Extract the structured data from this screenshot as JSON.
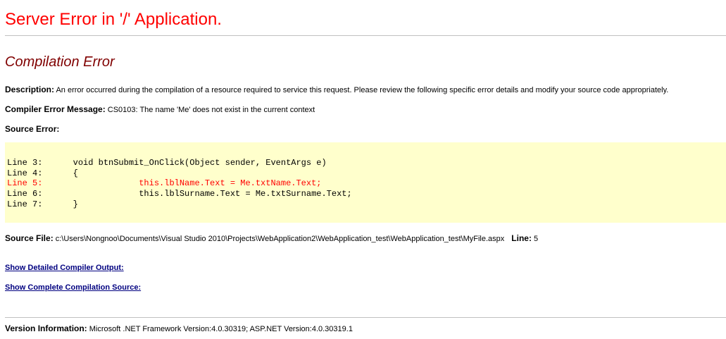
{
  "title": "Server Error in '/' Application.",
  "subtitle": "Compilation Error",
  "description": {
    "label": "Description:",
    "text": " An error occurred during the compilation of a resource required to service this request. Please review the following specific error details and modify your source code appropriately."
  },
  "compiler_message": {
    "label": "Compiler Error Message:",
    "text": " CS0103: The name 'Me' does not exist in the current context"
  },
  "source_error": {
    "label": "Source Error:"
  },
  "code_lines": [
    {
      "text": "Line 3:      void btnSubmit_OnClick(Object sender, EventArgs e)",
      "error": false
    },
    {
      "text": "Line 4:      {",
      "error": false
    },
    {
      "text": "Line 5:                   this.lblName.Text = Me.txtName.Text;",
      "error": true
    },
    {
      "text": "Line 6:                   this.lblSurname.Text = Me.txtSurname.Text;",
      "error": false
    },
    {
      "text": "Line 7:      }",
      "error": false
    }
  ],
  "source_file": {
    "label": "Source File:",
    "path": " c:\\Users\\Nongnoo\\Documents\\Visual Studio 2010\\Projects\\WebApplication2\\WebApplication_test\\WebApplication_test\\MyFile.aspx",
    "line_label": "Line:",
    "line_value": " 5"
  },
  "links": {
    "detailed_output": "Show Detailed Compiler Output:",
    "complete_source": "Show Complete Compilation Source:"
  },
  "version": {
    "label": "Version Information:",
    "text": " Microsoft .NET Framework Version:4.0.30319; ASP.NET Version:4.0.30319.1"
  },
  "colors": {
    "title": "#ff0000",
    "subtitle": "#800000",
    "code_background": "#ffffcc",
    "error_line": "#ff0000",
    "link": "#000080"
  }
}
